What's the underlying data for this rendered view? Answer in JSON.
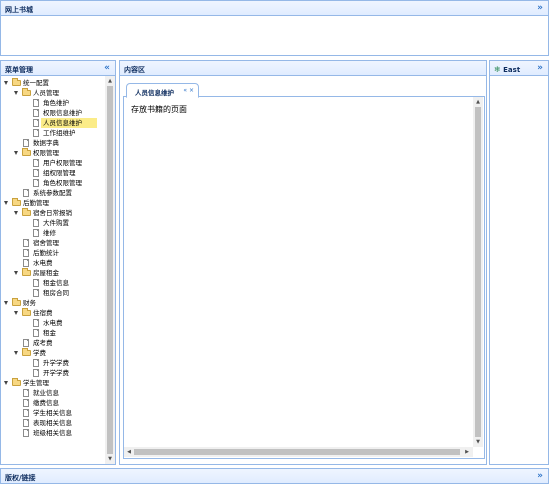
{
  "north": {
    "title": "网上书城",
    "collapse_icon": "double-chevron-up-icon"
  },
  "west": {
    "title": "菜单管理",
    "collapse_icon": "double-chevron-left-icon",
    "tree": [
      {
        "label": "统一配置",
        "type": "folder",
        "expanded": true,
        "level": 0
      },
      {
        "label": "人员管理",
        "type": "folder",
        "expanded": true,
        "level": 1
      },
      {
        "label": "角色维护",
        "type": "file",
        "level": 2
      },
      {
        "label": "权限信息维护",
        "type": "file",
        "level": 2
      },
      {
        "label": "人员信息维护",
        "type": "file",
        "level": 2,
        "selected": true
      },
      {
        "label": "工作组维护",
        "type": "file",
        "level": 2
      },
      {
        "label": "数据字典",
        "type": "file",
        "level": 1
      },
      {
        "label": "权限管理",
        "type": "folder",
        "expanded": true,
        "level": 1
      },
      {
        "label": "用户权限管理",
        "type": "file",
        "level": 2
      },
      {
        "label": "组权限管理",
        "type": "file",
        "level": 2
      },
      {
        "label": "角色权限管理",
        "type": "file",
        "level": 2
      },
      {
        "label": "系统参数配置",
        "type": "file",
        "level": 1
      },
      {
        "label": "后勤管理",
        "type": "folder",
        "expanded": true,
        "level": 0
      },
      {
        "label": "宿舍日常报销",
        "type": "folder",
        "expanded": true,
        "level": 1
      },
      {
        "label": "大件购置",
        "type": "file",
        "level": 2
      },
      {
        "label": "维修",
        "type": "file",
        "level": 2
      },
      {
        "label": "宿舍管理",
        "type": "file",
        "level": 1
      },
      {
        "label": "后勤统计",
        "type": "file",
        "level": 1
      },
      {
        "label": "水电费",
        "type": "file",
        "level": 1
      },
      {
        "label": "房屋租金",
        "type": "folder",
        "expanded": true,
        "level": 1
      },
      {
        "label": "租金信息",
        "type": "file",
        "level": 2
      },
      {
        "label": "租房合同",
        "type": "file",
        "level": 2
      },
      {
        "label": "财务",
        "type": "folder",
        "expanded": true,
        "level": 0
      },
      {
        "label": "住宿费",
        "type": "folder",
        "expanded": true,
        "level": 1
      },
      {
        "label": "水电费",
        "type": "file",
        "level": 2
      },
      {
        "label": "租金",
        "type": "file",
        "level": 2
      },
      {
        "label": "成考费",
        "type": "file",
        "level": 1
      },
      {
        "label": "学费",
        "type": "folder",
        "expanded": true,
        "level": 1
      },
      {
        "label": "升学学费",
        "type": "file",
        "level": 2
      },
      {
        "label": "开学学费",
        "type": "file",
        "level": 2
      },
      {
        "label": "学生管理",
        "type": "folder",
        "expanded": true,
        "level": 0
      },
      {
        "label": "就业信息",
        "type": "file",
        "level": 1
      },
      {
        "label": "缴费信息",
        "type": "file",
        "level": 1
      },
      {
        "label": "学生相关信息",
        "type": "file",
        "level": 1
      },
      {
        "label": "表现相关信息",
        "type": "file",
        "level": 1
      },
      {
        "label": "班级相关信息",
        "type": "file",
        "level": 1
      }
    ]
  },
  "center": {
    "title": "内容区",
    "tab": {
      "label": "人员信息维护",
      "refresh_icon": "refresh-icon",
      "close_icon": "close-icon"
    },
    "content_text": "存放书籍的页面"
  },
  "east": {
    "title": "East",
    "panel_icon": "east-panel-icon",
    "collapse_icon": "double-chevron-right-icon"
  },
  "south": {
    "title": "版权/链接",
    "collapse_icon": "double-chevron-down-icon"
  },
  "colors": {
    "border": "#95b8e7",
    "header_text": "#0e2d5f",
    "selected_row": "#fbec88",
    "folder": "#f7d782"
  }
}
